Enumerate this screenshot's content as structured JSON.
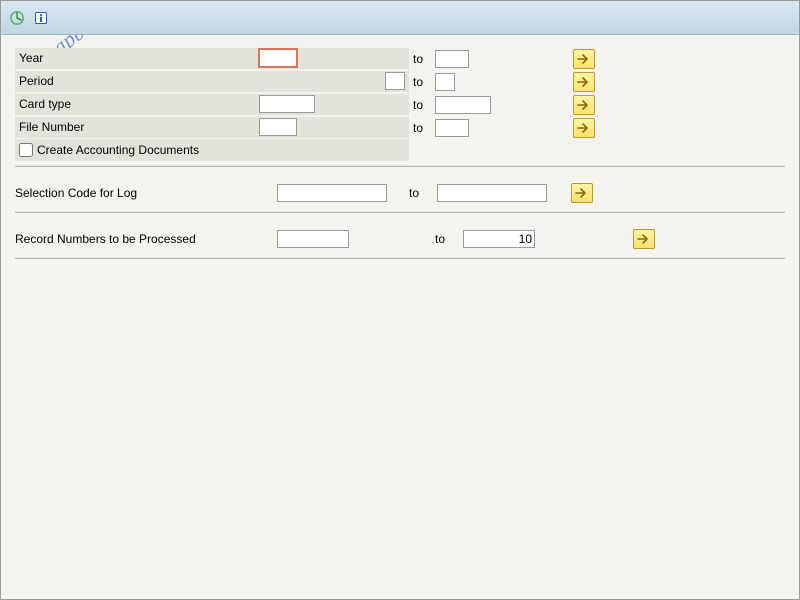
{
  "watermark": "sapbrainsonline.com",
  "toolbar": {
    "execute": "Execute",
    "info": "Information"
  },
  "fields": {
    "year": {
      "label": "Year",
      "from": "",
      "to": ""
    },
    "period": {
      "label": "Period",
      "from": "",
      "to": ""
    },
    "card_type": {
      "label": "Card type",
      "from": "",
      "to": ""
    },
    "file_number": {
      "label": "File Number",
      "from": "",
      "to": ""
    },
    "create_acct_docs": {
      "label": "Create Accounting Documents",
      "checked": false
    },
    "selection_code": {
      "label": "Selection Code for Log",
      "from": "",
      "to": ""
    },
    "record_numbers": {
      "label": "Record Numbers to be Processed",
      "from": "",
      "to": "10"
    }
  },
  "ui": {
    "to": "to"
  }
}
